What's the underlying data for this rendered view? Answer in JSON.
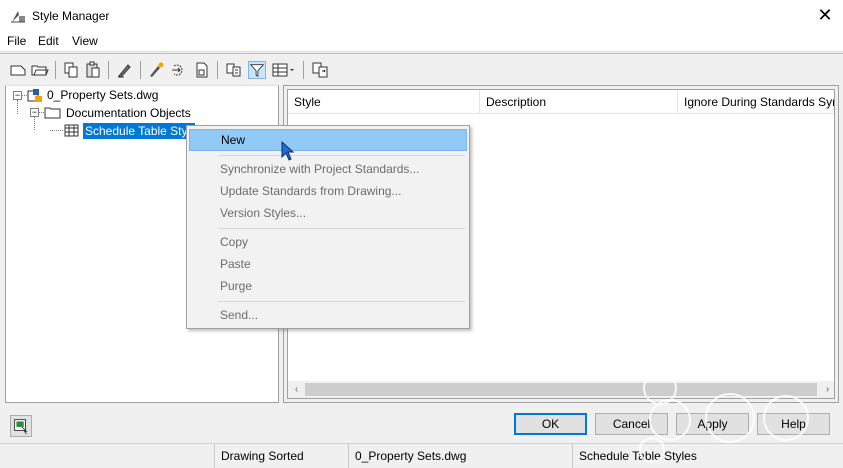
{
  "window": {
    "title": "Style Manager",
    "close_glyph": "✕"
  },
  "menu": [
    "File",
    "Edit",
    "View"
  ],
  "toolbar": {
    "icons": [
      "new-drawing-icon",
      "open-drawing-icon",
      "copy-icon",
      "paste-icon",
      "purge-icon",
      "new-style-icon",
      "edit-style-icon",
      "properties-icon",
      "sort-icon",
      "filter-icon",
      "view-toggle-icon",
      "synchronize-icon"
    ]
  },
  "tree": {
    "root": "0_Property Sets.dwg",
    "child": "Documentation Objects",
    "leaf": "Schedule Table Styles",
    "expander_minus": "−"
  },
  "list": {
    "columns": [
      "Style",
      "Description",
      "Ignore During Standards Syn"
    ],
    "arrow_left": "‹",
    "arrow_right": "›"
  },
  "context_menu": {
    "items": [
      "New",
      "Synchronize with Project Standards...",
      "Update Standards from Drawing...",
      "Version Styles...",
      "Copy",
      "Paste",
      "Purge",
      "Send..."
    ],
    "highlighted": "New"
  },
  "buttons": {
    "ok": "OK",
    "cancel": "Cancel",
    "apply": "Apply",
    "help": "Help"
  },
  "status": {
    "sort": "Drawing Sorted",
    "drawing": "0_Property Sets.dwg",
    "selection": "Schedule Table Styles"
  },
  "colors": {
    "selection": "#0078d7",
    "menu_highlight": "#91c9f7"
  }
}
